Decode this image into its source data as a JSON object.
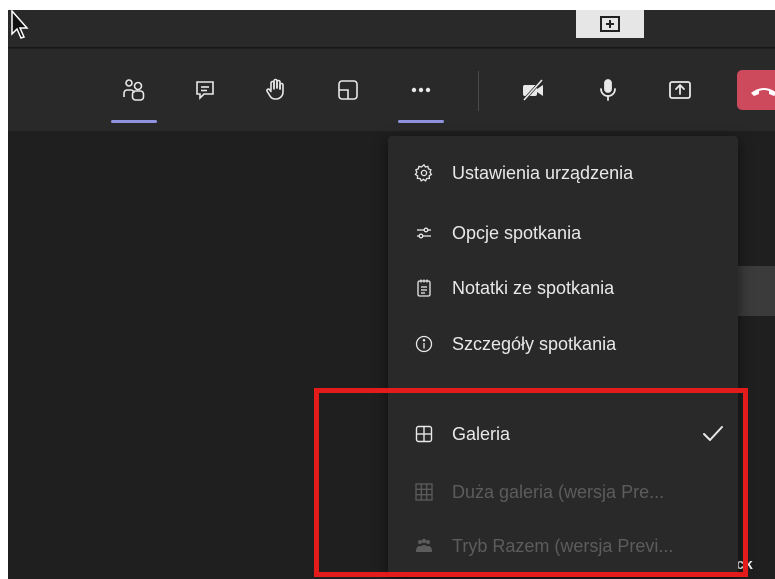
{
  "colors": {
    "toolbar_bg": "#292929",
    "stage_bg": "#1f1f1f",
    "menu_bg": "#292929",
    "accent_underline": "#8f92de",
    "hangup_red": "#cc4a5c",
    "highlight_red": "#e41b1b",
    "text": "#e8e8e8",
    "text_disabled": "#5c5c5c"
  },
  "toolbar": {
    "buttons": [
      {
        "icon": "people-icon",
        "active": true
      },
      {
        "icon": "chat-icon",
        "active": false
      },
      {
        "icon": "raise-hand-icon",
        "active": false
      },
      {
        "icon": "breakout-rooms-icon",
        "active": false
      },
      {
        "icon": "more-options-icon",
        "active": true
      },
      {
        "icon": "camera-off-icon",
        "active": false
      },
      {
        "icon": "microphone-icon",
        "active": false
      },
      {
        "icon": "share-screen-icon",
        "active": false
      },
      {
        "icon": "hang-up-icon",
        "active": false
      }
    ]
  },
  "menu": {
    "items": [
      {
        "icon": "gear-icon",
        "label": "Ustawienia urządzenia",
        "enabled": true
      },
      {
        "icon": "sliders-icon",
        "label": "Opcje spotkania",
        "enabled": true
      },
      {
        "icon": "notes-icon",
        "label": "Notatki ze spotkania",
        "enabled": true
      },
      {
        "icon": "info-icon",
        "label": "Szczegóły spotkania",
        "enabled": true
      },
      {
        "icon": "gallery-icon",
        "label": "Galeria",
        "enabled": true,
        "checked": true
      },
      {
        "icon": "large-gallery-icon",
        "label": "Duża galeria (wersja Pre...",
        "enabled": false
      },
      {
        "icon": "together-mode-icon",
        "label": "Tryb Razem (wersja Previ...",
        "enabled": false
      }
    ]
  },
  "background": {
    "edge_text": "ck"
  }
}
